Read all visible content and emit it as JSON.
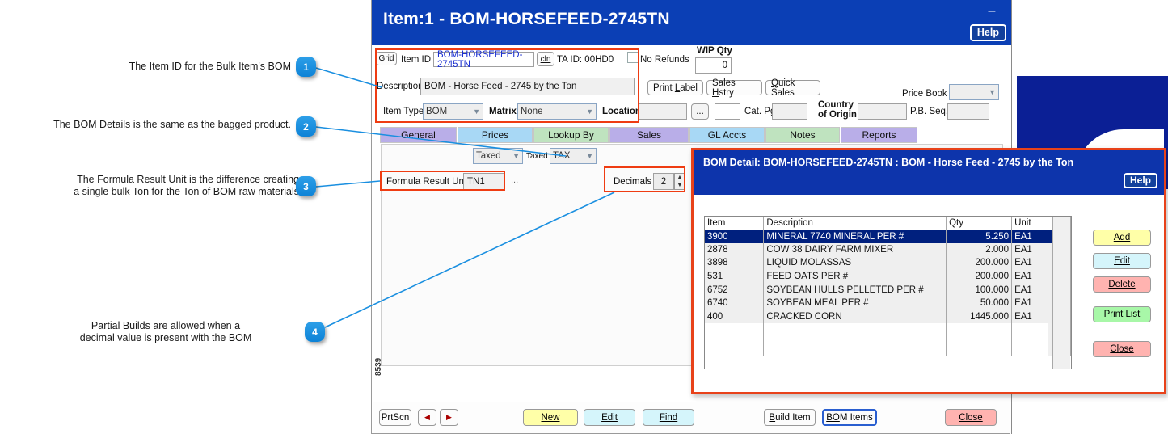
{
  "annotations": [
    {
      "n": "1",
      "text": "The Item ID for the Bulk Item's BOM"
    },
    {
      "n": "2",
      "text": "The BOM Details is the same as the bagged product."
    },
    {
      "n": "3",
      "text": "The Formula Result Unit is the difference creating\na single bulk Ton for the Ton of BOM raw materials"
    },
    {
      "n": "4",
      "text": "Partial Builds are allowed when a\ndecimal value is present with the BOM"
    }
  ],
  "main_window": {
    "title": "Item:1 - BOM-HORSEFEED-2745TN",
    "minimize_label": "–",
    "help_label": "Help",
    "side_code": "8539",
    "header": {
      "grid_button": "Grid",
      "item_id_label": "Item ID",
      "item_id_value": "BOM-HORSEFEED-2745TN",
      "cln_button": "cln",
      "ta_id_label": "TA ID: 00HD0",
      "no_refunds_label": "No Refunds",
      "wip_qty_label": "WIP Qty",
      "wip_qty_value": "0",
      "description_label": "Description",
      "description_value": "BOM - Horse Feed - 2745 by the Ton",
      "print_label_button": "Print Label",
      "sales_hstry_button": "Sales Hstry",
      "quick_sales_button": "Quick Sales",
      "price_book_label": "Price Book",
      "price_book_value": "",
      "item_type_label": "Item Type",
      "item_type_value": "BOM",
      "matrix_label": "Matrix",
      "matrix_value": "None",
      "location_label": "Location",
      "location_value": "",
      "ellipsis_button": "...",
      "location2_value": "",
      "cat_pg_label": "Cat. Pg.",
      "cat_pg_value": "",
      "country_of_origin_label": "Country\nof Origin",
      "country_of_origin_value": "",
      "pb_seq_label": "P.B. Seq.",
      "pb_seq_value": ""
    },
    "tabs": [
      {
        "label": "General",
        "color": "#b9aee8",
        "active": true
      },
      {
        "label": "Prices",
        "color": "#a8d8f5",
        "active": false
      },
      {
        "label": "Lookup By",
        "color": "#bfe3bf",
        "active": false
      },
      {
        "label": "Sales",
        "color": "#b9aee8",
        "active": false
      },
      {
        "label": "GL Accts",
        "color": "#a8d8f5",
        "active": false
      },
      {
        "label": "Notes",
        "color": "#bfe3bf",
        "active": false
      },
      {
        "label": "Reports",
        "color": "#b9aee8",
        "active": false
      }
    ],
    "panel": {
      "taxed_combo_value": "Taxed",
      "taxed_label": "Taxed",
      "tax_combo_value": "TAX",
      "formula_result_unit_label": "Formula Result Unit",
      "formula_result_unit_value": "TN1",
      "formula_ellipsis": "...",
      "decimals_label": "Decimals",
      "decimals_value": "2"
    },
    "footer": {
      "prtscn_button": "PrtScn",
      "prev_button": "◀",
      "next_button": "▶",
      "new_button": "New",
      "edit_button": "Edit",
      "find_button": "Find",
      "build_item_button": "Build Item",
      "bom_items_button": "BOM Items",
      "close_button": "Close"
    }
  },
  "bom_window": {
    "title": "BOM Detail: BOM-HORSEFEED-2745TN : BOM - Horse Feed - 2745 by the Ton",
    "help_label": "Help",
    "columns": [
      "Item",
      "Description",
      "Qty",
      "Unit"
    ],
    "rows": [
      {
        "item": "3900",
        "description": "MINERAL 7740 MINERAL PER #",
        "qty": "5.250",
        "unit": "EA1",
        "selected": true
      },
      {
        "item": "2878",
        "description": "COW 38 DAIRY FARM MIXER",
        "qty": "2.000",
        "unit": "EA1",
        "selected": false
      },
      {
        "item": "3898",
        "description": "LIQUID MOLASSAS",
        "qty": "200.000",
        "unit": "EA1",
        "selected": false
      },
      {
        "item": "531",
        "description": "FEED OATS PER #",
        "qty": "200.000",
        "unit": "EA1",
        "selected": false
      },
      {
        "item": "6752",
        "description": "SOYBEAN HULLS PELLETED PER #",
        "qty": "100.000",
        "unit": "EA1",
        "selected": false
      },
      {
        "item": "6740",
        "description": "SOYBEAN MEAL PER #",
        "qty": "50.000",
        "unit": "EA1",
        "selected": false
      },
      {
        "item": "400",
        "description": "CRACKED CORN",
        "qty": "1445.000",
        "unit": "EA1",
        "selected": false
      }
    ],
    "buttons": [
      {
        "label": "Add",
        "style": "yellow"
      },
      {
        "label": "Edit",
        "style": "cyan"
      },
      {
        "label": "Delete",
        "style": "red"
      },
      {
        "label": "Print List",
        "style": "green"
      },
      {
        "label": "Close",
        "style": "red"
      }
    ]
  }
}
